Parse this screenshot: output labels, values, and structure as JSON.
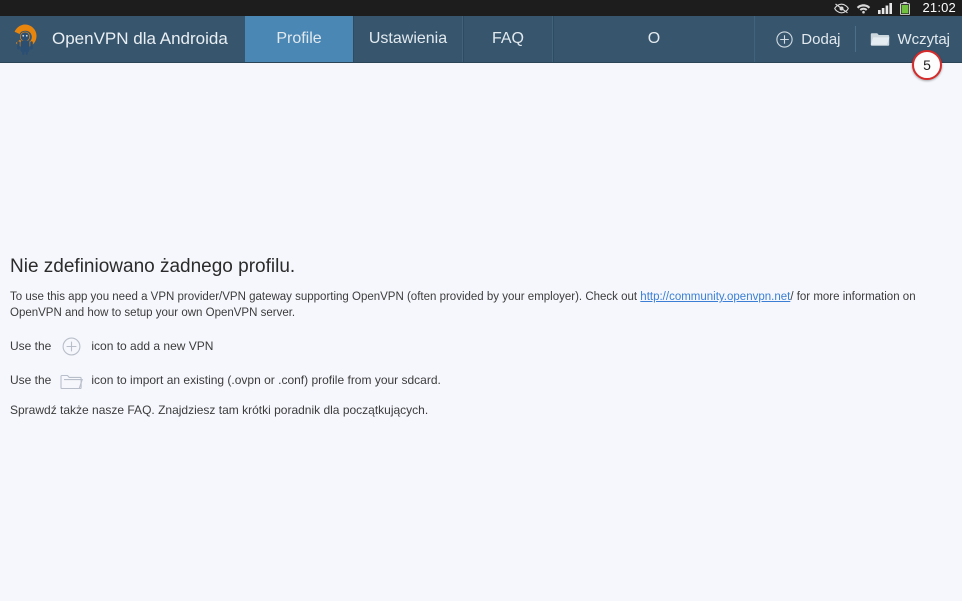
{
  "status_bar": {
    "time": "21:02",
    "icons": [
      "eye-icon",
      "wifi-icon",
      "signal-icon",
      "battery-icon"
    ]
  },
  "action_bar": {
    "app_title": "OpenVPN dla Androida",
    "logo_icon": "openvpn-android-logo",
    "tabs": [
      {
        "label": "Profile",
        "active": true
      },
      {
        "label": "Ustawienia",
        "active": false
      },
      {
        "label": "FAQ",
        "active": false
      },
      {
        "label": "O",
        "active": false
      }
    ],
    "actions": [
      {
        "label": "Dodaj",
        "icon": "circle-plus-icon"
      },
      {
        "label": "Wczytaj",
        "icon": "folder-icon"
      }
    ]
  },
  "badge": {
    "count": "5"
  },
  "content": {
    "empty_title": "Nie zdefiniowano żadnego profilu.",
    "paragraph_before_link": "To use this app you need a VPN provider/VPN gateway supporting OpenVPN (often provided by your employer). Check out ",
    "link_text": "http://community.openvpn.net",
    "paragraph_after_link": "/ for more information on OpenVPN and how to setup your own OpenVPN server.",
    "hints": [
      {
        "prefix": "Use the",
        "icon": "circle-plus-icon",
        "suffix": "icon to add a new VPN"
      },
      {
        "prefix": "Use the",
        "icon": "folder-icon",
        "suffix": "icon to import an existing (.ovpn or .conf) profile from your sdcard."
      }
    ],
    "faq_note": "Sprawdź także nasze FAQ. Znajdziesz tam krótki poradnik dla początkujących."
  },
  "colors": {
    "action_bar_bg": "#37566e",
    "active_tab_bg": "#4a87b4",
    "status_bar_bg": "#1d1d1d",
    "content_bg": "#f6f7fc",
    "link": "#3a7fd5",
    "badge_border": "#d52b2b",
    "logo_orange": "#e8850c",
    "logo_body": "#2b4f73"
  }
}
